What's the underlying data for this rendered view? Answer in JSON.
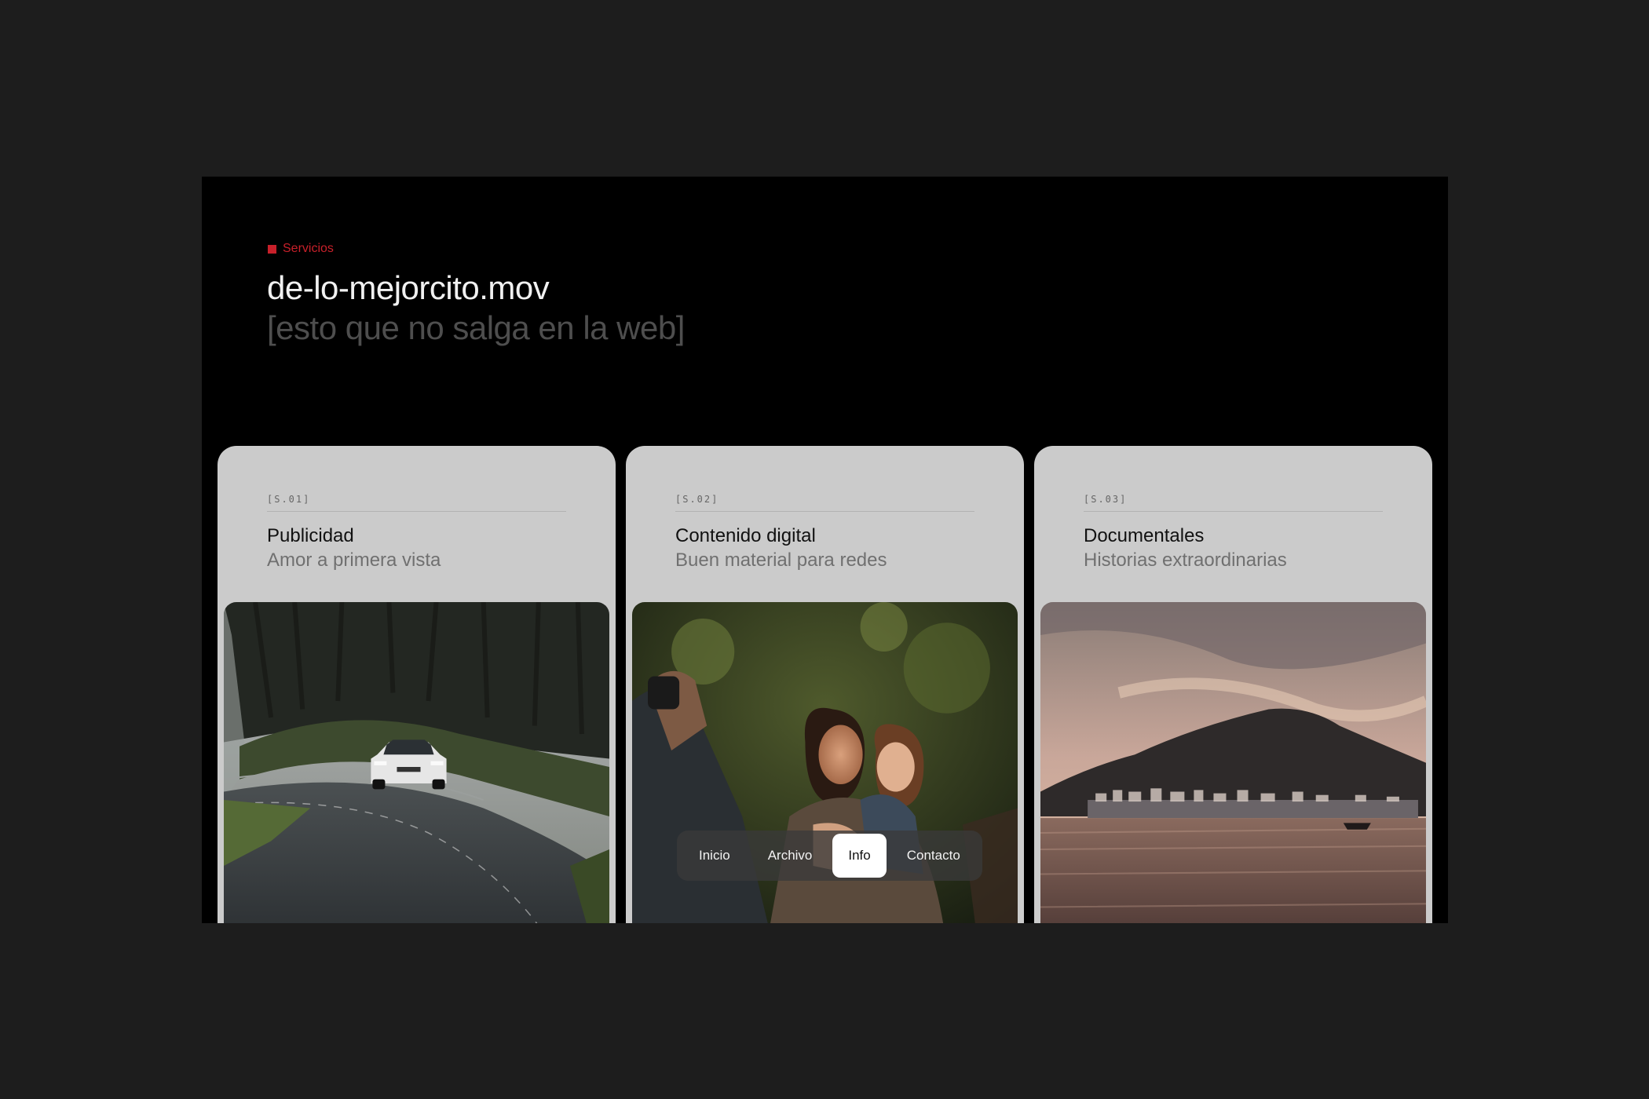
{
  "header": {
    "section_label": "Servicios",
    "title": "de-lo-mejorcito.mov",
    "subtitle": "[esto que no salga en la web]"
  },
  "services": [
    {
      "code": "[S.01]",
      "name": "Publicidad",
      "tagline": "Amor a primera vista",
      "image": "car-on-winding-forest-road"
    },
    {
      "code": "[S.02]",
      "name": "Contenido digital",
      "tagline": "Buen material para redes",
      "image": "mother-and-daughter-embracing"
    },
    {
      "code": "[S.03]",
      "name": "Documentales",
      "tagline": "Historias extraordinarias",
      "image": "coastal-town-at-sunset"
    }
  ],
  "nav": {
    "items": [
      {
        "label": "Inicio"
      },
      {
        "label": "Archivo"
      },
      {
        "label": "Info",
        "active": true
      },
      {
        "label": "Contacto"
      }
    ]
  },
  "colors": {
    "accent": "#c8202a",
    "card_bg": "#cbcbcb",
    "page_bg": "#1d1d1d",
    "frame_bg": "#000000"
  }
}
